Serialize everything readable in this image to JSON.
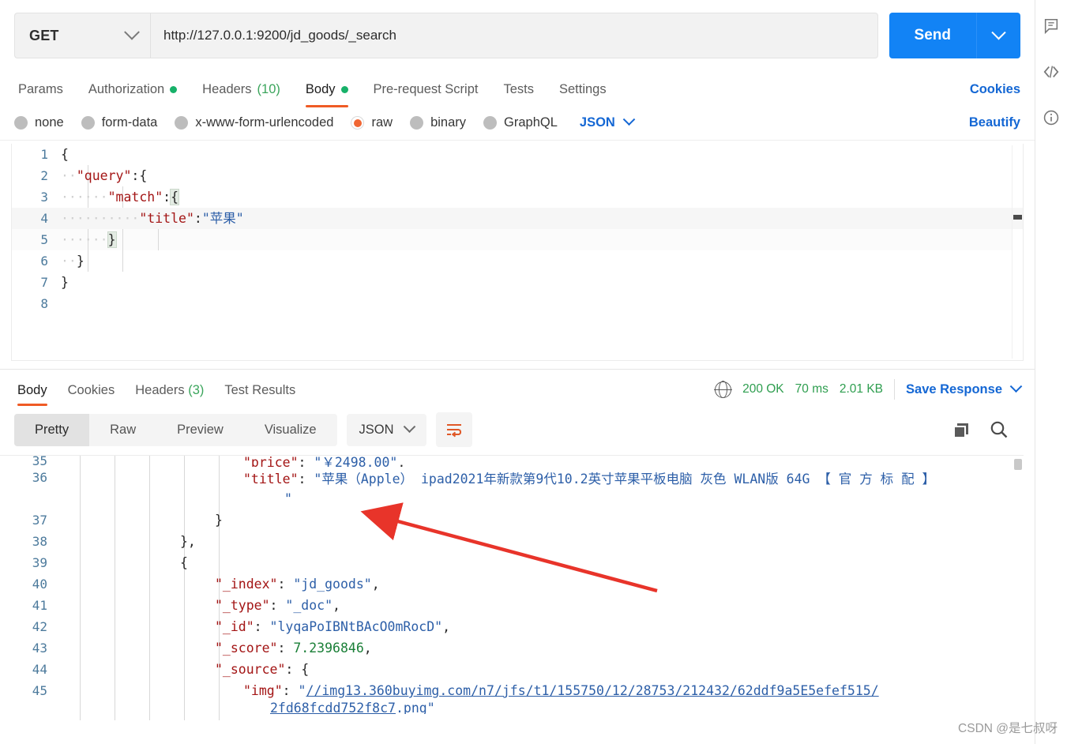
{
  "request": {
    "method": "GET",
    "url": "http://127.0.0.1:9200/jd_goods/_search",
    "send_label": "Send",
    "tabs": [
      {
        "label": "Params",
        "badge": "",
        "count": "",
        "active": false
      },
      {
        "label": "Authorization",
        "badge": "dot",
        "count": "",
        "active": false
      },
      {
        "label": "Headers",
        "badge": "",
        "count": "(10)",
        "active": false
      },
      {
        "label": "Body",
        "badge": "dot",
        "count": "",
        "active": true
      },
      {
        "label": "Pre-request Script",
        "badge": "",
        "count": "",
        "active": false
      },
      {
        "label": "Tests",
        "badge": "",
        "count": "",
        "active": false
      },
      {
        "label": "Settings",
        "badge": "",
        "count": "",
        "active": false
      }
    ],
    "cookies_label": "Cookies",
    "body_types": [
      {
        "label": "none",
        "selected": false
      },
      {
        "label": "form-data",
        "selected": false
      },
      {
        "label": "x-www-form-urlencoded",
        "selected": false
      },
      {
        "label": "raw",
        "selected": true
      },
      {
        "label": "binary",
        "selected": false
      },
      {
        "label": "GraphQL",
        "selected": false
      }
    ],
    "format": "JSON",
    "beautify_label": "Beautify",
    "editor_lines": [
      {
        "n": "1",
        "text": "{"
      },
      {
        "n": "2",
        "text": "··\"query\":{"
      },
      {
        "n": "3",
        "text": "······\"match\":{"
      },
      {
        "n": "4",
        "text": "··········\"title\":\"苹果\""
      },
      {
        "n": "5",
        "text": "······}"
      },
      {
        "n": "6",
        "text": "··}"
      },
      {
        "n": "7",
        "text": "}"
      },
      {
        "n": "8",
        "text": ""
      }
    ]
  },
  "response": {
    "tabs": [
      {
        "label": "Body",
        "count": "",
        "active": true
      },
      {
        "label": "Cookies",
        "count": "",
        "active": false
      },
      {
        "label": "Headers",
        "count": "(3)",
        "active": false
      },
      {
        "label": "Test Results",
        "count": "",
        "active": false
      }
    ],
    "status": "200 OK",
    "time": "70 ms",
    "size": "2.01 KB",
    "save_response_label": "Save Response",
    "view_modes": [
      {
        "label": "Pretty",
        "active": true
      },
      {
        "label": "Raw",
        "active": false
      },
      {
        "label": "Preview",
        "active": false
      },
      {
        "label": "Visualize",
        "active": false
      }
    ],
    "format": "JSON",
    "lines": [
      {
        "n": "35",
        "indent": 7,
        "text": "\"price\": \"￥2498.00\","
      },
      {
        "n": "36",
        "indent": 6,
        "text": "\"title\": \"苹果（Apple） ipad2021年新款第9代10.2英寸苹果平板电脑 灰色 WLAN版 64G 【 官 方 标 配 】"
      },
      {
        "n": "36b",
        "indent": 6,
        "text": "\""
      },
      {
        "n": "37",
        "indent": 5,
        "text": "}"
      },
      {
        "n": "38",
        "indent": 4,
        "text": "},"
      },
      {
        "n": "39",
        "indent": 4,
        "text": "{"
      },
      {
        "n": "40",
        "indent": 5,
        "text": "\"_index\": \"jd_goods\","
      },
      {
        "n": "41",
        "indent": 5,
        "text": "\"_type\": \"_doc\","
      },
      {
        "n": "42",
        "indent": 5,
        "text": "\"_id\": \"lyqaPoIBNtBAcO0mRocD\","
      },
      {
        "n": "43",
        "indent": 5,
        "text": "\"_score\": 7.2396846,"
      },
      {
        "n": "44",
        "indent": 5,
        "text": "\"_source\": {"
      },
      {
        "n": "45",
        "indent": 6,
        "text": "\"img\": \"//img13.360buyimg.com/n7/jfs/t1/155750/12/28753/212432/62ddf9a5E5efef515/"
      },
      {
        "n": "45b",
        "indent": 7,
        "text": "2fd68fcdd752f8c7.png\""
      }
    ]
  },
  "watermark": "CSDN @是七叔呀",
  "colors": {
    "accent_orange": "#ef5b25",
    "link_blue": "#1467d4",
    "send_blue": "#1283f5",
    "status_green": "#2e9e4f",
    "annotation_red": "#e8342a"
  }
}
